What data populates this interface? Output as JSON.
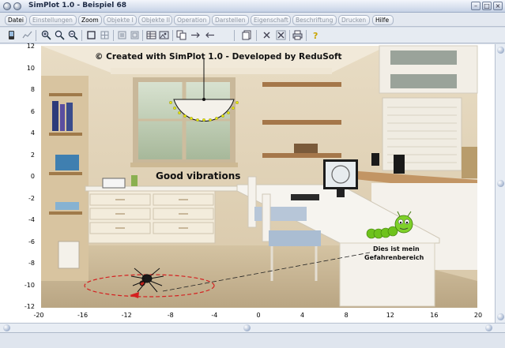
{
  "window": {
    "title": "SimPlot 1.0 - Beispiel 68"
  },
  "menu": [
    {
      "label": "Datei",
      "enabled": true
    },
    {
      "label": "Einstellungen",
      "enabled": false
    },
    {
      "label": "Zoom",
      "enabled": true
    },
    {
      "label": "Objekte I",
      "enabled": false
    },
    {
      "label": "Objekte II",
      "enabled": false
    },
    {
      "label": "Operation",
      "enabled": false
    },
    {
      "label": "Darstellen",
      "enabled": false
    },
    {
      "label": "Eigenschaft",
      "enabled": false
    },
    {
      "label": "Beschriftung",
      "enabled": false
    },
    {
      "label": "Drucken",
      "enabled": false
    },
    {
      "label": "Hilfe",
      "enabled": true
    }
  ],
  "toolbar": {
    "icons": [
      "device-icon",
      "chart-icon",
      "zoom-in-icon",
      "zoom-reset-icon",
      "zoom-out-icon",
      "frame-icon",
      "grid-icon",
      "select-icon",
      "select-all-icon",
      "table-icon",
      "image-icon",
      "copy-icon",
      "arrow-right-icon",
      "arrow-left-icon",
      "pages-icon",
      "delete-icon",
      "clear-icon",
      "print-icon",
      "help-icon"
    ]
  },
  "plot": {
    "copyright": "© Created with SimPlot 1.0 - Developed by ReduSoft",
    "caption": "Good vibrations",
    "annotation_line1": "Dies ist mein",
    "annotation_line2": "Gefahrenbereich",
    "x_ticks": [
      "-20",
      "-16",
      "-12",
      "-8",
      "-4",
      "0",
      "4",
      "8",
      "12",
      "16",
      "20"
    ],
    "y_ticks": [
      "12",
      "10",
      "8",
      "6",
      "4",
      "2",
      "0",
      "-2",
      "-4",
      "-6",
      "-8",
      "-10",
      "-12"
    ],
    "colors": {
      "ellipse": "#d42020",
      "pendulum": "#f0f000",
      "caterpillar": "#6ec21c"
    }
  }
}
